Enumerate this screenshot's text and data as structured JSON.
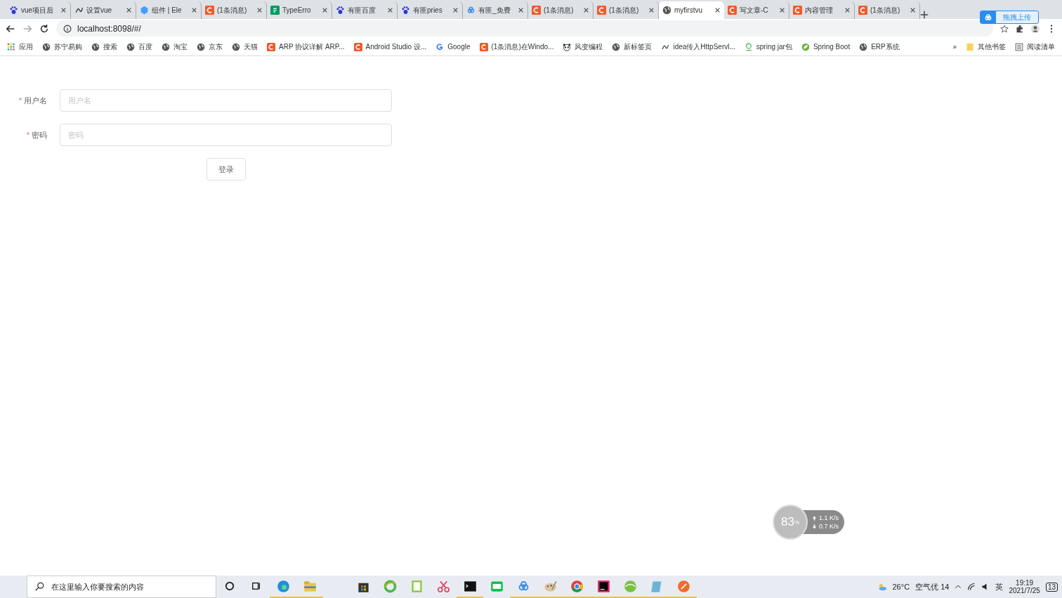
{
  "browser": {
    "tabs": [
      {
        "title": "vue项目后",
        "kind": "paw",
        "selected": false
      },
      {
        "title": "设置vue",
        "kind": "script",
        "selected": false
      },
      {
        "title": "组件 | Ele",
        "kind": "element",
        "selected": false
      },
      {
        "title": "(1条消息)",
        "kind": "csdn",
        "selected": false
      },
      {
        "title": "TypeErro",
        "kind": "sf",
        "selected": false
      },
      {
        "title": "有匪百度",
        "kind": "paw",
        "selected": false
      },
      {
        "title": "有匪pries",
        "kind": "paw",
        "selected": false
      },
      {
        "title": "有匪_免费",
        "kind": "cloud",
        "selected": false
      },
      {
        "title": "(1条消息)",
        "kind": "csdn",
        "selected": false
      },
      {
        "title": "(1条消息)",
        "kind": "csdn",
        "selected": false
      },
      {
        "title": "myfirstvu",
        "kind": "globe",
        "selected": true
      },
      {
        "title": "写文章-C",
        "kind": "csdn",
        "selected": false
      },
      {
        "title": "内容管理",
        "kind": "csdn",
        "selected": false
      },
      {
        "title": "(1条消息)",
        "kind": "csdn",
        "selected": false
      }
    ],
    "address": "localhost:8098/#/",
    "upload_badge": "拖拽上传",
    "bookmarks": [
      {
        "label": "应用",
        "kind": "apps"
      },
      {
        "label": "苏宁易购",
        "kind": "globe"
      },
      {
        "label": "搜索",
        "kind": "globe"
      },
      {
        "label": "百度",
        "kind": "globe"
      },
      {
        "label": "淘宝",
        "kind": "globe"
      },
      {
        "label": "京东",
        "kind": "globe"
      },
      {
        "label": "天猫",
        "kind": "globe"
      },
      {
        "label": "ARP 协议详解 ARP...",
        "kind": "csdn"
      },
      {
        "label": "Android Studio 设...",
        "kind": "csdn"
      },
      {
        "label": "Google",
        "kind": "google"
      },
      {
        "label": "(1条消息)在Windo...",
        "kind": "csdn"
      },
      {
        "label": "风变编程",
        "kind": "panda"
      },
      {
        "label": "新标签页",
        "kind": "globe"
      },
      {
        "label": "idea传入HttpServl...",
        "kind": "script"
      },
      {
        "label": "spring jar包",
        "kind": "leaf"
      },
      {
        "label": "Spring Boot",
        "kind": "spring"
      },
      {
        "label": "ERP系统",
        "kind": "globe"
      }
    ],
    "more": "»",
    "other_bookmarks": "其他书签",
    "reading_list": "阅读清单"
  },
  "form": {
    "fields": [
      {
        "label": "用户名",
        "required": true,
        "required_mark": "*",
        "placeholder": "用户名"
      },
      {
        "label": "密码",
        "required": true,
        "required_mark": "*",
        "placeholder": "密码"
      }
    ],
    "submit": "登录"
  },
  "speed_widget": {
    "percent": "83",
    "unit": "%",
    "upload": "1.1",
    "upload_unit": "K/s",
    "download": "0.7",
    "download_unit": "K/s"
  },
  "taskbar": {
    "search_placeholder": "在这里输入你要搜索的内容",
    "apps": [
      {
        "kind": "edge",
        "running": true
      },
      {
        "kind": "folder",
        "running": true
      },
      {
        "kind": "store",
        "running": false
      },
      {
        "kind": "ie",
        "running": false
      },
      {
        "kind": "notepad",
        "running": false
      },
      {
        "kind": "scissors",
        "running": false
      },
      {
        "kind": "terminal",
        "running": true
      },
      {
        "kind": "tv",
        "running": false
      },
      {
        "kind": "cloud",
        "running": true
      },
      {
        "kind": "paint",
        "running": true
      },
      {
        "kind": "chrome",
        "running": true
      },
      {
        "kind": "ide",
        "running": true
      },
      {
        "kind": "ball",
        "running": true
      },
      {
        "kind": "note",
        "running": true
      },
      {
        "kind": "rocket",
        "running": true
      }
    ],
    "temperature": "26°C",
    "air": "空气优 14",
    "ime": "英",
    "time": "19:19",
    "date": "2021/7/25",
    "notifications": "13"
  }
}
